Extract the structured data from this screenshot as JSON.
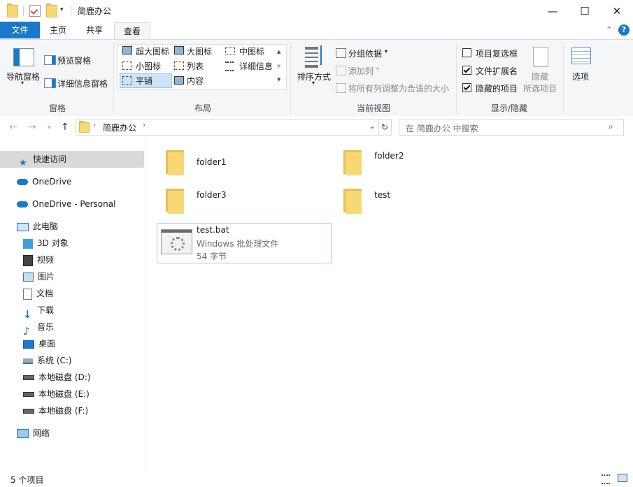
{
  "window": {
    "title": "简鹿办公",
    "controls": {
      "minimize": "—",
      "maximize": "☐",
      "close": "✕"
    }
  },
  "ribbon": {
    "tabs": [
      {
        "label": "文件"
      },
      {
        "label": "主页"
      },
      {
        "label": "共享"
      },
      {
        "label": "查看"
      }
    ],
    "active_tab": "查看",
    "groups": {
      "panes": {
        "label": "窗格",
        "nav_pane": "导航窗格",
        "preview_pane": "预览窗格",
        "details_pane": "详细信息窗格"
      },
      "layout": {
        "label": "布局",
        "options": [
          "超大图标",
          "大图标",
          "中图标",
          "小图标",
          "列表",
          "详细信息",
          "平铺",
          "内容"
        ],
        "selected": "平铺"
      },
      "current_view": {
        "label": "当前视图",
        "sort_by": "排序方式",
        "group_by": "分组依据",
        "add_columns": "添加列",
        "size_columns": "将所有列调整为合适的大小"
      },
      "show_hide": {
        "label": "显示/隐藏",
        "item_checkboxes": {
          "label": "项目复选框",
          "checked": false
        },
        "file_extensions": {
          "label": "文件扩展名",
          "checked": true
        },
        "hidden_items": {
          "label": "隐藏的项目",
          "checked": true
        },
        "hide_selected_line1": "隐藏",
        "hide_selected_line2": "所选项目"
      },
      "options": {
        "label": "选项"
      }
    }
  },
  "address": {
    "path": [
      "简鹿办公"
    ],
    "search_placeholder": "在 简鹿办公 中搜索"
  },
  "nav_pane": {
    "quick_access": "快速访问",
    "onedrive": "OneDrive",
    "onedrive_personal": "OneDrive - Personal",
    "this_pc": "此电脑",
    "pc_items": [
      "3D 对象",
      "视频",
      "图片",
      "文档",
      "下载",
      "音乐",
      "桌面",
      "系统 (C:)",
      "本地磁盘 (D:)",
      "本地磁盘 (E:)",
      "本地磁盘 (F:)"
    ],
    "network": "网络"
  },
  "content": {
    "folders": [
      "folder1",
      "folder2",
      "folder3",
      "test"
    ],
    "file": {
      "name": "test.bat",
      "type": "Windows 批处理文件",
      "size": "54 字节"
    }
  },
  "status": {
    "count": "5 个项目"
  },
  "colors": {
    "file_tab": "#1979ca",
    "folder": "#f8d775",
    "selection_border": "#99d1ff",
    "help": "#1979ca"
  }
}
